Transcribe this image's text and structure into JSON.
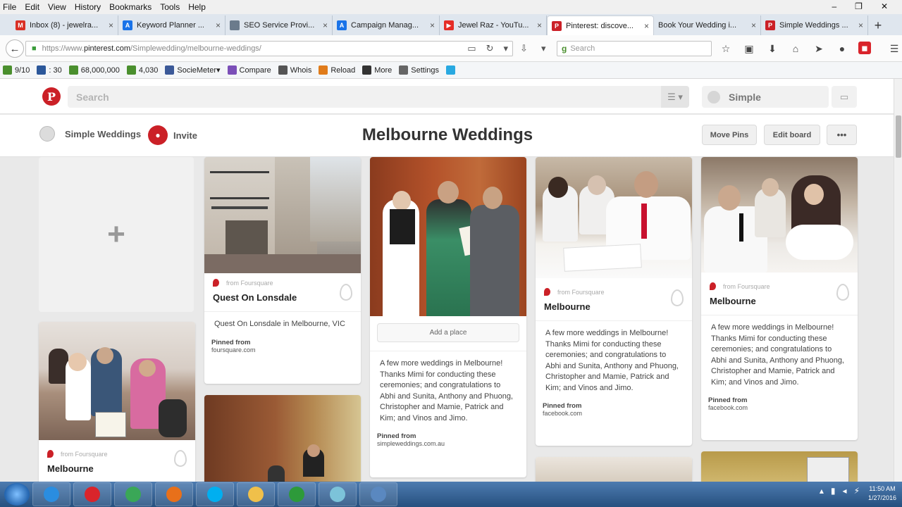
{
  "menu": [
    "File",
    "Edit",
    "View",
    "History",
    "Bookmarks",
    "Tools",
    "Help"
  ],
  "tabs": [
    {
      "title": "Inbox (8) - jewelra...",
      "icon": "gmail-icon",
      "color": "#d93025",
      "glyph": "M"
    },
    {
      "title": "Keyword Planner ...",
      "icon": "adwords-icon",
      "color": "#1a73e8",
      "glyph": "A"
    },
    {
      "title": "SEO Service Provi...",
      "icon": "page-icon",
      "color": "#6b7b8c",
      "glyph": ""
    },
    {
      "title": "Campaign Manag...",
      "icon": "adwords-icon",
      "color": "#1a73e8",
      "glyph": "A"
    },
    {
      "title": "Jewel Raz - YouTu...",
      "icon": "youtube-icon",
      "color": "#e52d27",
      "glyph": "▶"
    },
    {
      "title": "Pinterest: discove...",
      "icon": "pinterest-icon",
      "color": "#cb2027",
      "glyph": "P",
      "active": true
    },
    {
      "title": "Book Your Wedding i...",
      "icon": "",
      "color": "",
      "glyph": ""
    },
    {
      "title": "Simple Weddings ...",
      "icon": "pinterest-icon",
      "color": "#cb2027",
      "glyph": "P"
    }
  ],
  "nav": {
    "url_prefix": "https://www.",
    "url_host": "pinterest.com",
    "url_path": "/Simplewedding/melbourne-weddings/",
    "search_placeholder": "Search"
  },
  "toolbar2": [
    {
      "label": "9/10",
      "icon": "google-pagerank-icon",
      "color": "#4a8f2e"
    },
    {
      "label": ": 30",
      "icon": "info-icon",
      "color": "#2b579a"
    },
    {
      "label": "68,000,000",
      "icon": "google-index-icon",
      "color": "#4a8f2e"
    },
    {
      "label": "4,030",
      "icon": "google-backlinks-icon",
      "color": "#4a8f2e"
    },
    {
      "label": "SocieMeter▾",
      "icon": "sociometer-icon",
      "color": "#3b5998"
    },
    {
      "label": "Compare",
      "icon": "compare-icon",
      "color": "#7b4fb8"
    },
    {
      "label": "Whois",
      "icon": "whois-icon",
      "color": "#555555"
    },
    {
      "label": "Reload",
      "icon": "reload-icon",
      "color": "#e07b1a"
    },
    {
      "label": "More",
      "icon": "more-icon",
      "color": "#333333"
    },
    {
      "label": "Settings",
      "icon": "settings-icon",
      "color": "#666666"
    }
  ],
  "pinterest": {
    "search_placeholder": "Search",
    "profile_name": "Simple",
    "board": {
      "owner": "Simple Weddings",
      "invite": "Invite",
      "title": "Melbourne Weddings",
      "move_pins": "Move Pins",
      "edit_board": "Edit board",
      "more": "•••"
    },
    "add_card": "+",
    "pins": [
      {
        "source": "from Foursquare",
        "name": "Quest On Lonsdale",
        "desc": "Quest On Lonsdale in Melbourne, VIC",
        "pinned_label": "Pinned from",
        "pinned_from": "foursquare.com"
      },
      {
        "add_place": "Add a place",
        "desc": "A few more weddings in Melbourne! Thanks Mimi for conducting these ceremonies; and congratulations to Abhi and Sunita, Anthony and Phuong, Christopher and Mamie, Patrick and Kim; and Vinos and Jimo.",
        "pinned_label": "Pinned from",
        "pinned_from": "simpleweddings.com.au"
      },
      {
        "source": "from Foursquare",
        "name": "Melbourne",
        "desc": "A few more weddings in Melbourne! Thanks Mimi for conducting these ceremonies; and congratulations to Abhi and Sunita, Anthony and Phuong, Christopher and Mamie, Patrick and Kim; and Vinos and Jimo.",
        "pinned_label": "Pinned from",
        "pinned_from": "facebook.com"
      },
      {
        "source": "from Foursquare",
        "name": "Melbourne",
        "desc": "A few more weddings in Melbourne! Thanks Mimi for conducting these ceremonies; and congratulations to Abhi and Sunita, Anthony and Phuong, Christopher and Mamie, Patrick and Kim; and Vinos and Jimo.",
        "pinned_label": "Pinned from",
        "pinned_from": "facebook.com"
      },
      {
        "source": "from Foursquare",
        "name": "Melbourne"
      }
    ]
  },
  "taskbar": {
    "apps": [
      {
        "name": "ie-icon",
        "color": "#2a8de0"
      },
      {
        "name": "opera-icon",
        "color": "#d9242b"
      },
      {
        "name": "chrome-icon",
        "color": "#3aa757"
      },
      {
        "name": "firefox-icon",
        "color": "#e8701a"
      },
      {
        "name": "skype-icon",
        "color": "#00aff0"
      },
      {
        "name": "explorer-icon",
        "color": "#f0c04a"
      },
      {
        "name": "globe-icon",
        "color": "#2d9a3a"
      },
      {
        "name": "notes-icon",
        "color": "#7cc3d9"
      },
      {
        "name": "photo-icon",
        "color": "#5a88c0"
      }
    ],
    "time": "11:50 AM",
    "date": "1/27/2016"
  }
}
